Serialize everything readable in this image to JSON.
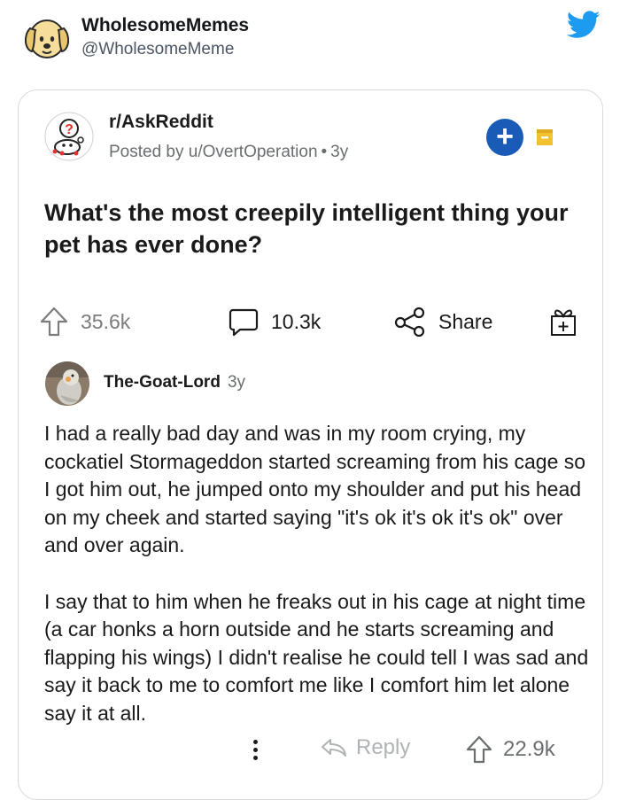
{
  "tweet": {
    "name": "WholesomeMemes",
    "handle": "@WholesomeMeme"
  },
  "post": {
    "subreddit": "r/AskReddit",
    "posted_by": "Posted by u/OvertOperation",
    "separator": "•",
    "age": "3y",
    "title": "What's the most creepily intelligent thing your pet has ever done?",
    "upvotes": "35.6k",
    "comments": "10.3k",
    "share_label": "Share"
  },
  "comment": {
    "author": "The-Goat-Lord",
    "age": "3y",
    "paragraphs": [
      "I had a really bad day and was in my room  crying, my cockatiel Stormageddon started screaming from his cage so I got him out, he jumped onto my shoulder and put his head on my cheek and started saying \"it's ok it's ok it's ok\" over and over again.",
      "I say that to him when he freaks out in his cage at night time (a car honks a horn outside and he starts screaming and flapping his wings) I didn't realise he could tell I was sad and say it back to me to comfort me like I comfort him let alone say it at all."
    ],
    "reply_label": "Reply",
    "votes": "22.9k"
  },
  "colors": {
    "twitter_blue": "#1d9bf0",
    "join_blue": "#1b5bb8",
    "save_yellow": "#f2c12e"
  },
  "icons": [
    "dog-avatar-icon",
    "twitter-bird-icon",
    "snoo-question-icon",
    "plus-icon",
    "save-icon",
    "upvote-icon",
    "comment-icon",
    "share-icon",
    "award-icon",
    "more-icon",
    "reply-icon"
  ]
}
